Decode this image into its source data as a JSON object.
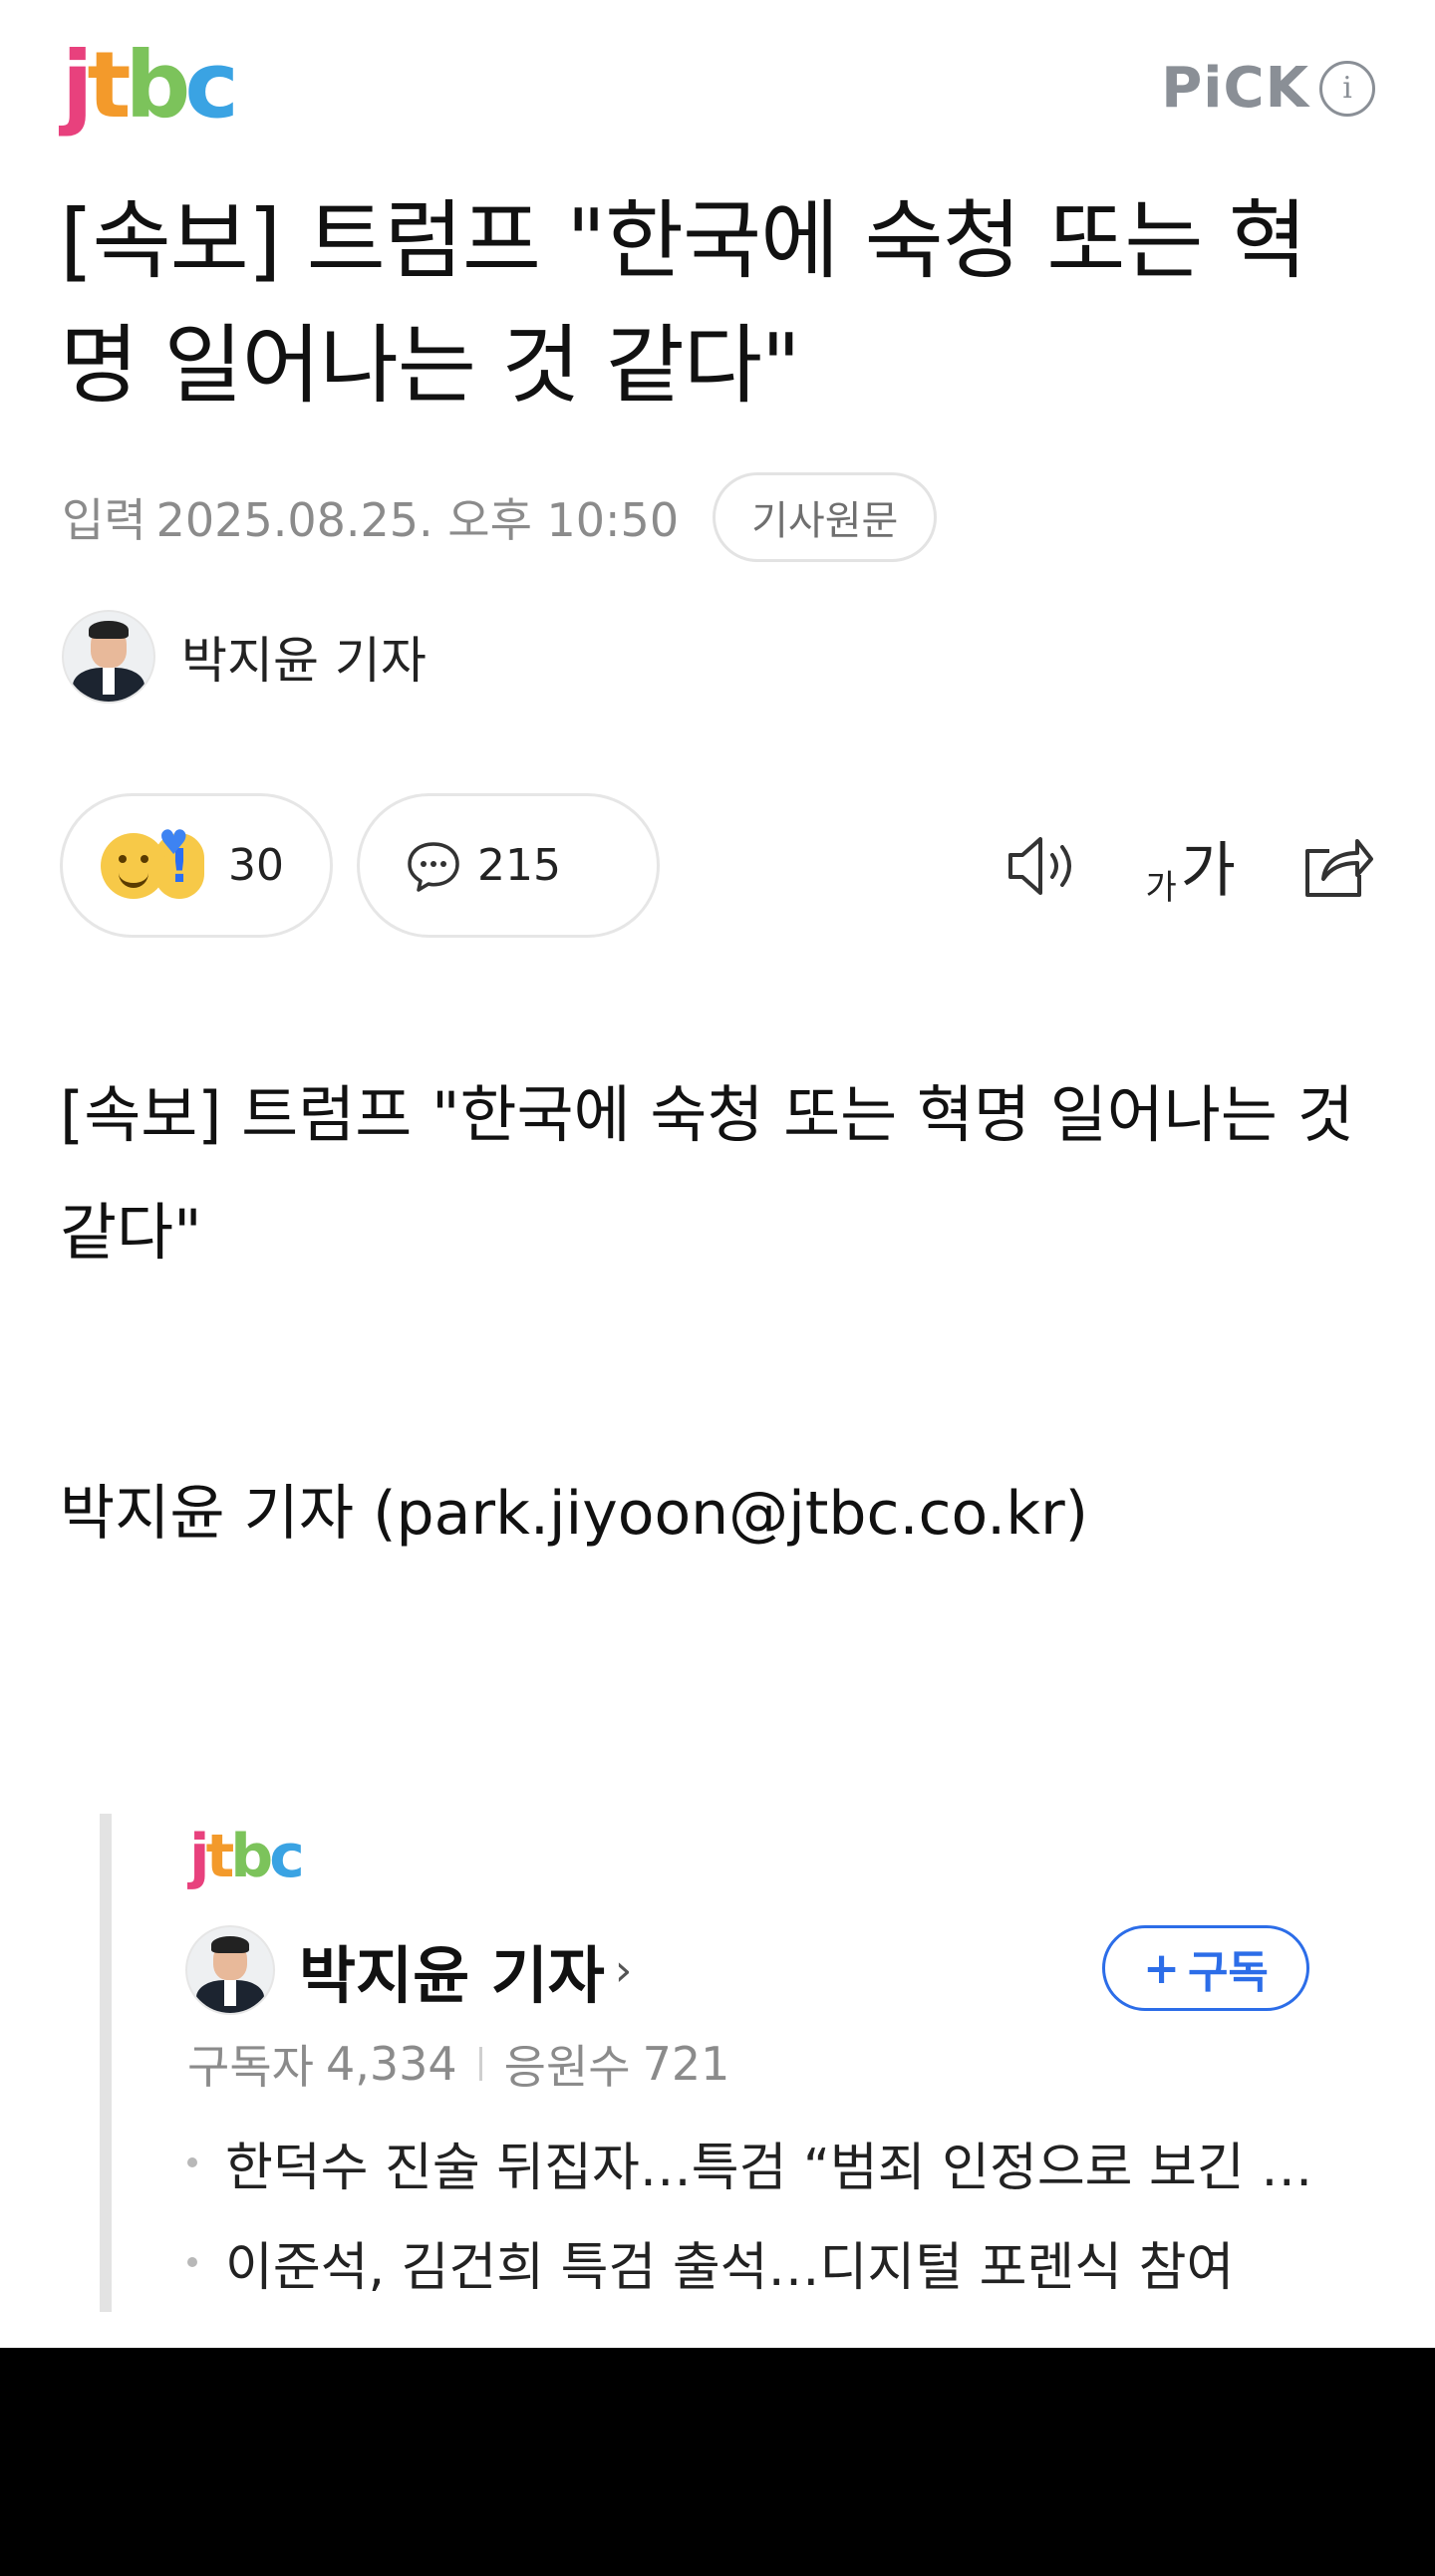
{
  "header": {
    "logo_letters": [
      {
        "char": "j",
        "color": "#e8417d"
      },
      {
        "char": "t",
        "color": "#f39a2b"
      },
      {
        "char": "b",
        "color": "#7cc35b"
      },
      {
        "char": "c",
        "color": "#3aa3e3"
      }
    ],
    "pick_label": "PiCK",
    "pick_info": "i"
  },
  "article": {
    "headline": "[속보] 트럼프 \"한국에 숙청 또는 혁명 일어나는 것 같다\"",
    "input_label": "입력",
    "date": "2025.08.25. 오후 10:50",
    "original_label": "기사원문",
    "reporter": "박지윤 기자",
    "body": "[속보] 트럼프 \"한국에 숙청 또는 혁명 일어나는 것 같다\"",
    "byline": "박지윤 기자 (park.jiyoon@jtbc.co.kr)"
  },
  "reactions": {
    "reaction_count": "30",
    "comment_count": "215",
    "font_small": "가",
    "font_large": "가"
  },
  "card": {
    "reporter": "박지윤 기자",
    "chevron": "›",
    "subscribe_plus": "+",
    "subscribe_label": "구독",
    "subscribers_label": "구독자",
    "subscribers": "4,334",
    "cheers_label": "응원수",
    "cheers": "721",
    "articles": [
      "한덕수 진술 뒤집자…특검 “범죄 인정으로 보긴 모...",
      "이준석, 김건희 특검 출석…디지털 포렌식 참여"
    ]
  },
  "colors": {
    "accent_blue": "#2c6de8",
    "muted_gray": "#8b8b8b"
  }
}
